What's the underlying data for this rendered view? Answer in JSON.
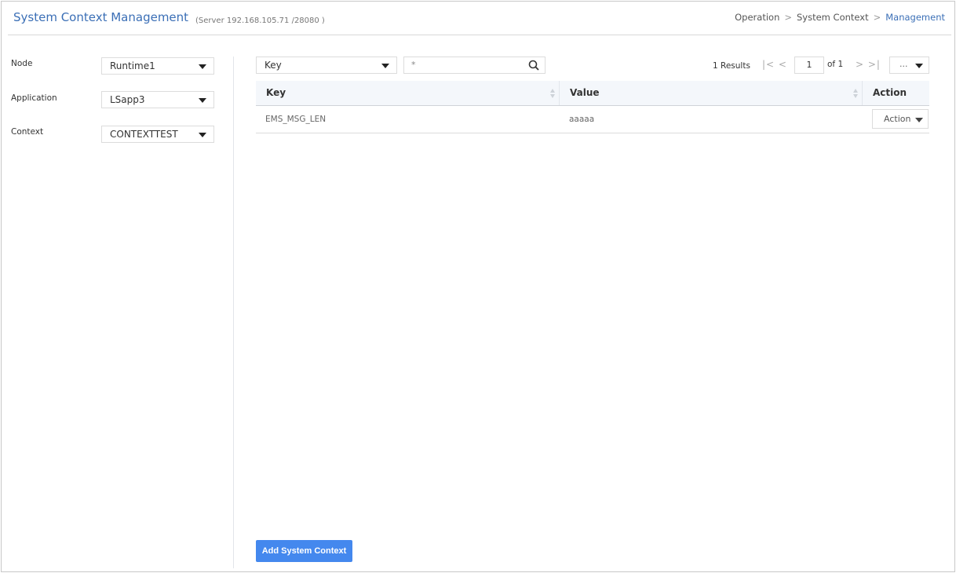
{
  "header": {
    "title": "System Context Management",
    "server": "(Server 192.168.105.71 /28080 )",
    "breadcrumb": [
      "Operation",
      "System Context",
      "Management"
    ],
    "breadcrumb_sep": ">"
  },
  "filters": {
    "node": {
      "label": "Node",
      "value": "Runtime1"
    },
    "application": {
      "label": "Application",
      "value": "LSapp3"
    },
    "context": {
      "label": "Context",
      "value": "CONTEXTTEST"
    }
  },
  "search": {
    "field_select": "Key",
    "query": "*"
  },
  "pagination": {
    "results": "1 Results",
    "first_prev": "|< <",
    "page": "1",
    "of": "of 1",
    "next_last": "> >|",
    "more": "..."
  },
  "table": {
    "columns": [
      "Key",
      "Value",
      "Action"
    ],
    "rows": [
      {
        "key": "EMS_MSG_LEN",
        "value": "aaaaa",
        "action": "Action"
      }
    ]
  },
  "footer": {
    "add_button": "Add System Context"
  },
  "colors": {
    "accent": "#3b6fb6",
    "primary_button": "#4488ee"
  }
}
